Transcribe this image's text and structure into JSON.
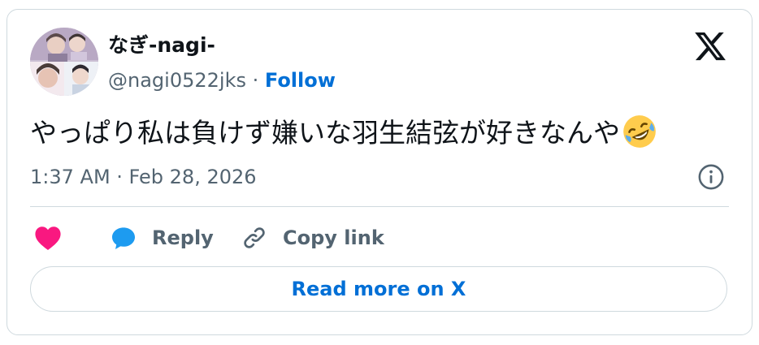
{
  "author": {
    "display_name": "なぎ-nagi-",
    "handle": "@nagi0522jks",
    "separator": "·",
    "follow_label": "Follow"
  },
  "tweet": {
    "text": "やっぱり私は負けず嫌いな羽生結弦が好きなんや",
    "emoji": "rolling-on-the-floor-laughing",
    "timestamp": "1:37 AM · Feb 28, 2026"
  },
  "actions": {
    "like_icon": "heart-icon",
    "reply_label": "Reply",
    "copy_link_label": "Copy link"
  },
  "footer": {
    "read_more_label": "Read more on X"
  },
  "colors": {
    "accent": "#006fd6",
    "like": "#f91880",
    "reply": "#1d9bf0",
    "muted": "#536471",
    "border": "#cfd9de"
  }
}
